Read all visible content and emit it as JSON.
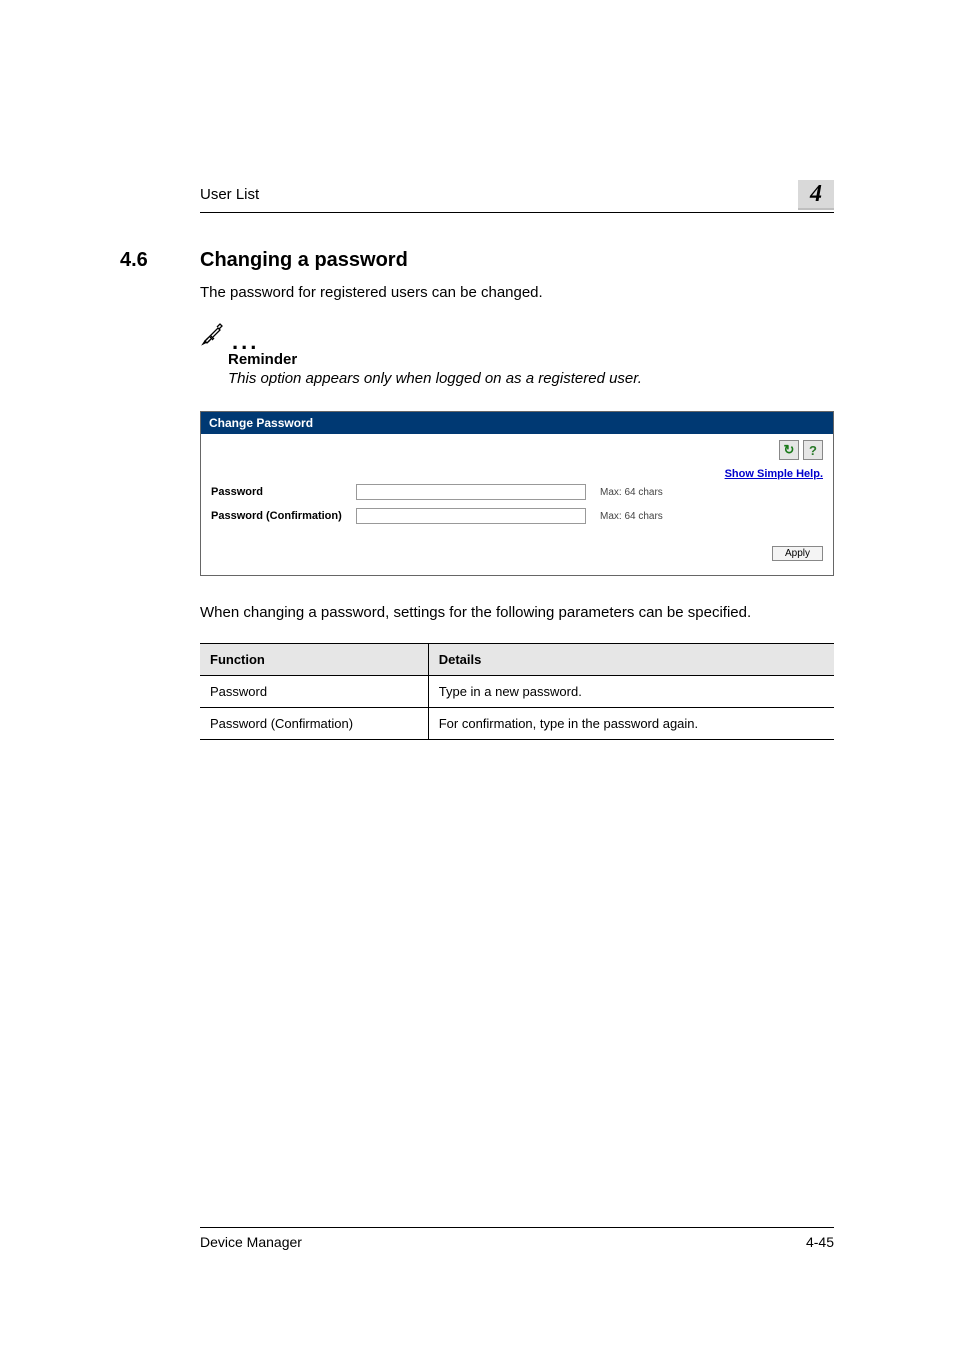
{
  "header": {
    "section_label": "User List",
    "chapter_number": "4"
  },
  "heading": {
    "number": "4.6",
    "text": "Changing a password"
  },
  "intro": "The password for registered users can be changed.",
  "reminder": {
    "title": "Reminder",
    "text": "This option appears only when logged on as a registered user."
  },
  "shot": {
    "title": "Change Password",
    "help_link": "Show Simple Help.",
    "rows": [
      {
        "label": "Password",
        "hint": "Max: 64 chars"
      },
      {
        "label": "Password (Confirmation)",
        "hint": "Max: 64 chars"
      }
    ],
    "apply": "Apply"
  },
  "after_text": "When changing a password, settings for the following parameters can be specified.",
  "table": {
    "headers": [
      "Function",
      "Details"
    ],
    "rows": [
      [
        "Password",
        "Type in a new password."
      ],
      [
        "Password (Confirmation)",
        "For confirmation, type in the password again."
      ]
    ]
  },
  "footer": {
    "left": "Device Manager",
    "right": "4-45"
  }
}
